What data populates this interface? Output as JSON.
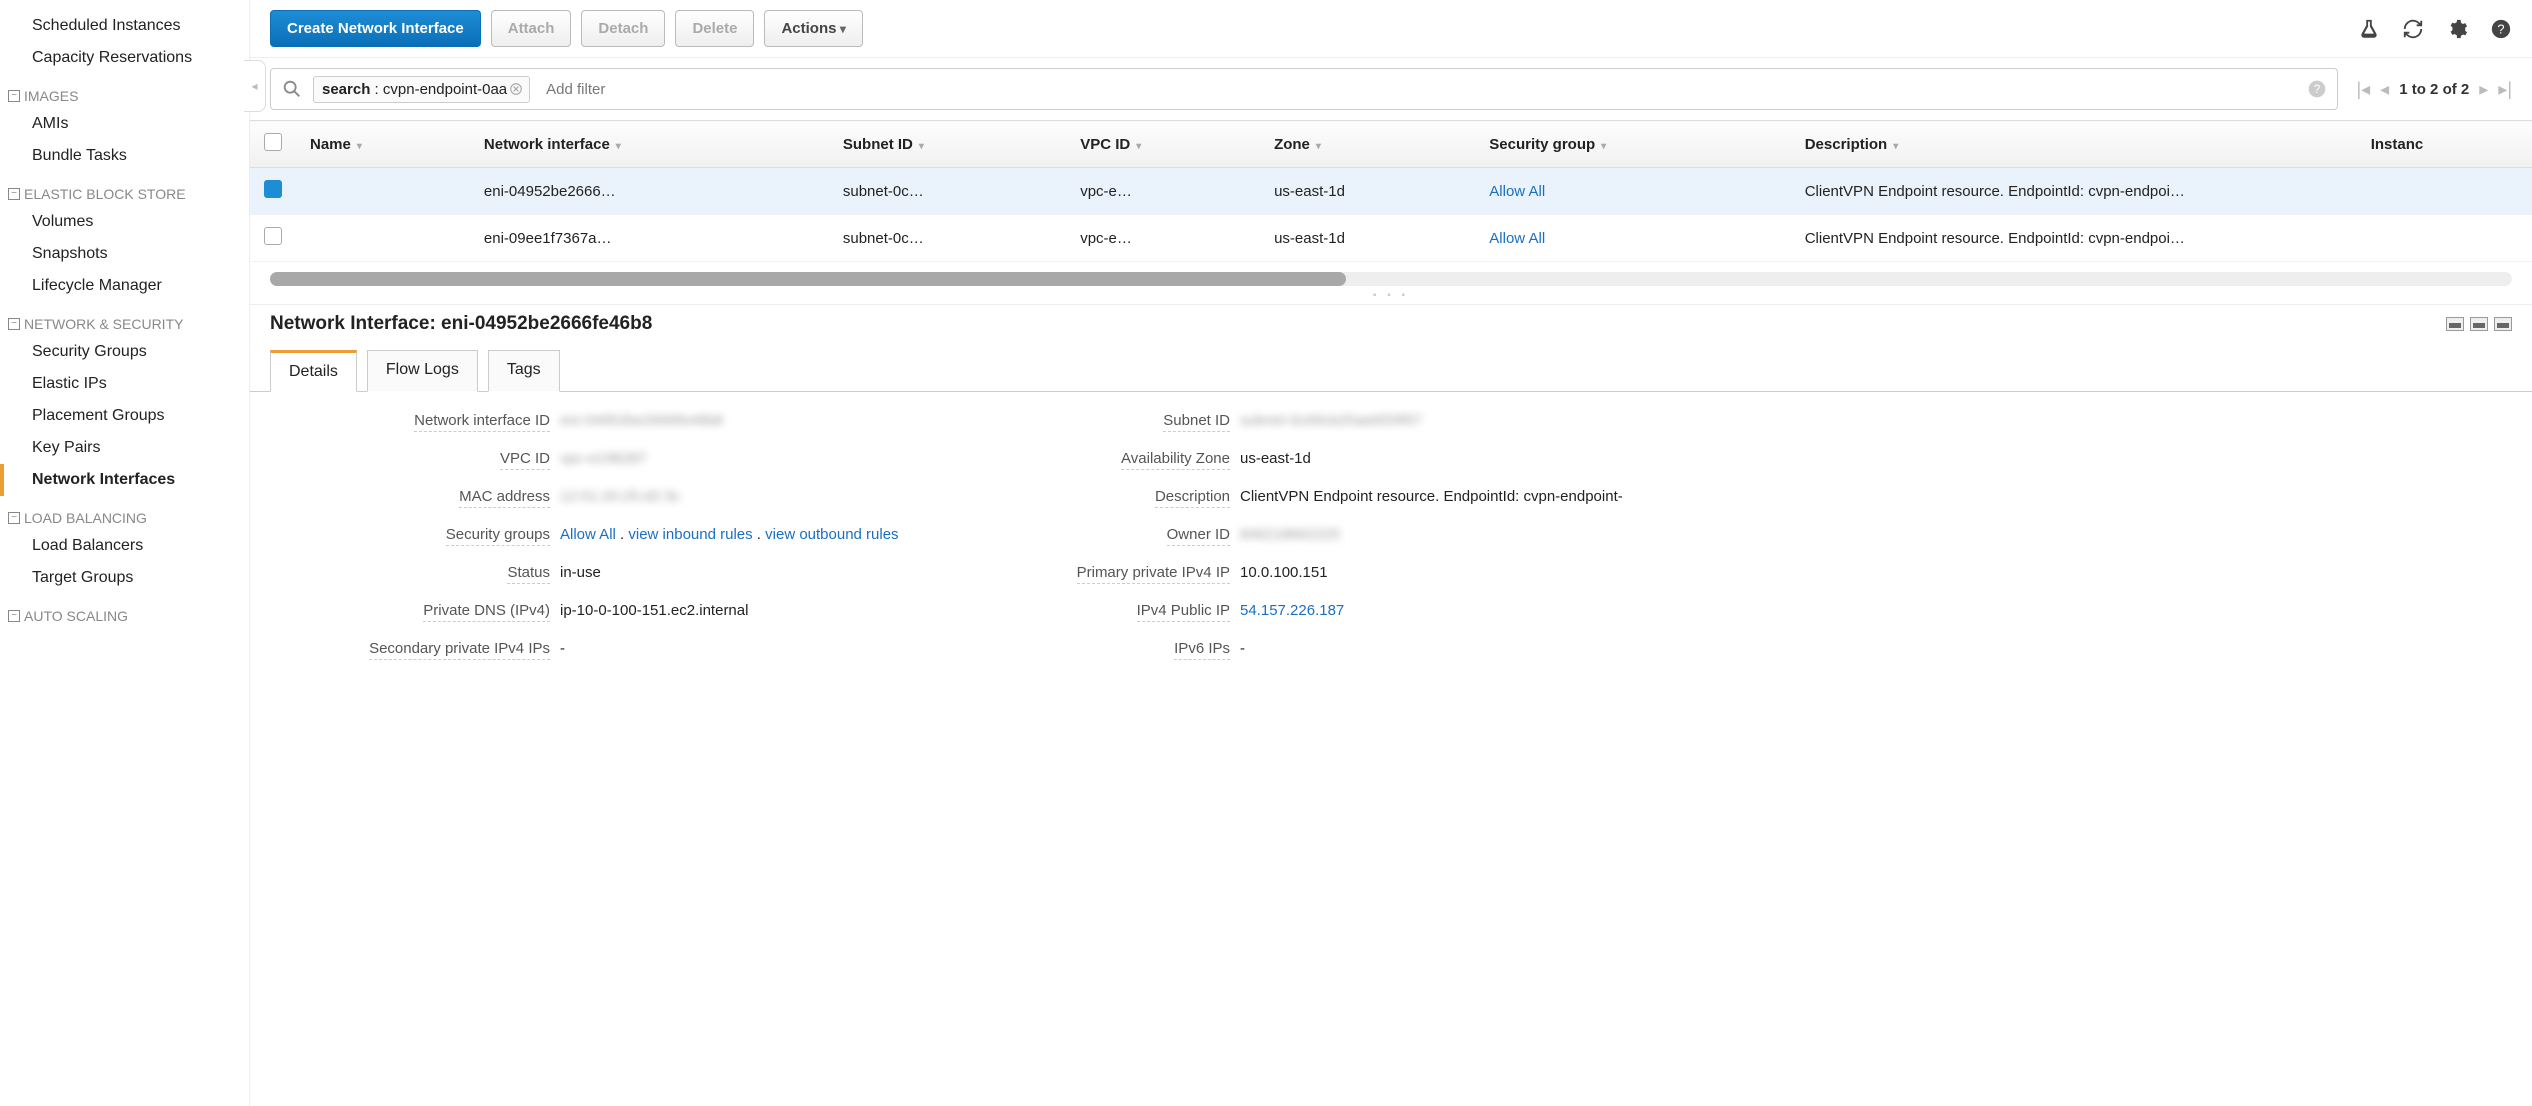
{
  "sidebar": {
    "items_top": [
      {
        "label": "Scheduled Instances"
      },
      {
        "label": "Capacity Reservations"
      }
    ],
    "section_images": "IMAGES",
    "items_images": [
      {
        "label": "AMIs"
      },
      {
        "label": "Bundle Tasks"
      }
    ],
    "section_ebs": "ELASTIC BLOCK STORE",
    "items_ebs": [
      {
        "label": "Volumes"
      },
      {
        "label": "Snapshots"
      },
      {
        "label": "Lifecycle Manager"
      }
    ],
    "section_netsec": "NETWORK & SECURITY",
    "items_netsec": [
      {
        "label": "Security Groups"
      },
      {
        "label": "Elastic IPs"
      },
      {
        "label": "Placement Groups"
      },
      {
        "label": "Key Pairs"
      },
      {
        "label": "Network Interfaces"
      }
    ],
    "section_lb": "LOAD BALANCING",
    "items_lb": [
      {
        "label": "Load Balancers"
      },
      {
        "label": "Target Groups"
      }
    ],
    "section_as": "AUTO SCALING"
  },
  "toolbar": {
    "create": "Create Network Interface",
    "attach": "Attach",
    "detach": "Detach",
    "delete": "Delete",
    "actions": "Actions"
  },
  "search": {
    "tag_key": "search",
    "tag_value": "cvpn-endpoint-0aa",
    "add_filter": "Add filter"
  },
  "pager": {
    "label": "1 to 2 of 2"
  },
  "columns": {
    "name": "Name",
    "eni": "Network interface",
    "subnet": "Subnet ID",
    "vpc": "VPC ID",
    "zone": "Zone",
    "sg": "Security group",
    "desc": "Description",
    "inst": "Instanc"
  },
  "rows": [
    {
      "selected": true,
      "name": "",
      "eni": "eni-04952be2666…",
      "subnet": "subnet-0c…",
      "vpc": "vpc-e…",
      "zone": "us-east-1d",
      "sg": "Allow All",
      "desc": "ClientVPN Endpoint resource. EndpointId: cvpn-endpoi…"
    },
    {
      "selected": false,
      "name": "",
      "eni": "eni-09ee1f7367a…",
      "subnet": "subnet-0c…",
      "vpc": "vpc-e…",
      "zone": "us-east-1d",
      "sg": "Allow All",
      "desc": "ClientVPN Endpoint resource. EndpointId: cvpn-endpoi…"
    }
  ],
  "detail": {
    "title": "Network Interface: eni-04952be2666fe46b8",
    "tabs": {
      "details": "Details",
      "flow": "Flow Logs",
      "tags": "Tags"
    },
    "kv": {
      "eni_id_k": "Network interface ID",
      "eni_id_v": "eni-04952be2666fe46b8",
      "subnet_k": "Subnet ID",
      "subnet_v": "subnet-0c69cb25aebf29f97",
      "vpc_k": "VPC ID",
      "vpc_v": "vpc-e198287",
      "az_k": "Availability Zone",
      "az_v": "us-east-1d",
      "mac_k": "MAC address",
      "mac_v": "12:51:20:25:d2:3c",
      "desc_k": "Description",
      "desc_v": "ClientVPN Endpoint resource. EndpointId: cvpn-endpoint-",
      "sg_k": "Security groups",
      "sg_link": "Allow All",
      "sg_in": "view inbound rules",
      "sg_out": "view outbound rules",
      "owner_k": "Owner ID",
      "owner_v": "846218662225",
      "status_k": "Status",
      "status_v": "in-use",
      "ppip_k": "Primary private IPv4 IP",
      "ppip_v": "10.0.100.151",
      "pdns_k": "Private DNS (IPv4)",
      "pdns_v": "ip-10-0-100-151.ec2.internal",
      "pub_k": "IPv4 Public IP",
      "pub_v": "54.157.226.187",
      "sec_k": "Secondary private IPv4 IPs",
      "sec_v": "-",
      "v6_k": "IPv6 IPs",
      "v6_v": "-"
    }
  }
}
